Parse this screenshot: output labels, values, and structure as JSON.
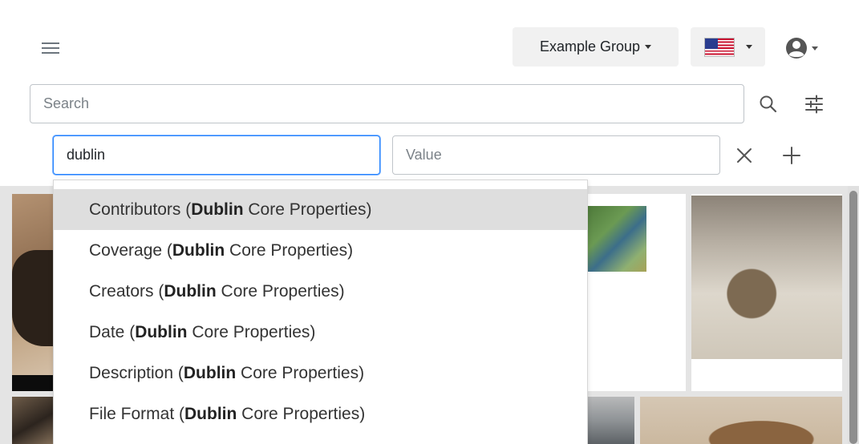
{
  "header": {
    "menu_icon": "hamburger-icon",
    "group_label": "Example Group",
    "language_flag": "us-flag-icon",
    "user_icon": "user-circle-icon"
  },
  "search": {
    "placeholder": "Search",
    "value": "",
    "search_icon": "search-icon",
    "filter_icon": "sliders-icon"
  },
  "filter": {
    "key_value": "dublin",
    "value_placeholder": "Value",
    "remove_icon": "close-icon",
    "add_icon": "plus-icon"
  },
  "autocomplete": {
    "match": "Dublin",
    "items": [
      {
        "prefix": "Contributors (",
        "suffix": " Core Properties)",
        "active": true
      },
      {
        "prefix": "Coverage (",
        "suffix": " Core Properties)",
        "active": false
      },
      {
        "prefix": "Creators (",
        "suffix": " Core Properties)",
        "active": false
      },
      {
        "prefix": "Date (",
        "suffix": " Core Properties)",
        "active": false
      },
      {
        "prefix": "Description (",
        "suffix": " Core Properties)",
        "active": false
      },
      {
        "prefix": "File Format (",
        "suffix": " Core Properties)",
        "active": false
      }
    ]
  },
  "colors": {
    "focus_border": "#2684ff",
    "active_item_bg": "#dedede",
    "button_bg": "#f1f1f1"
  }
}
